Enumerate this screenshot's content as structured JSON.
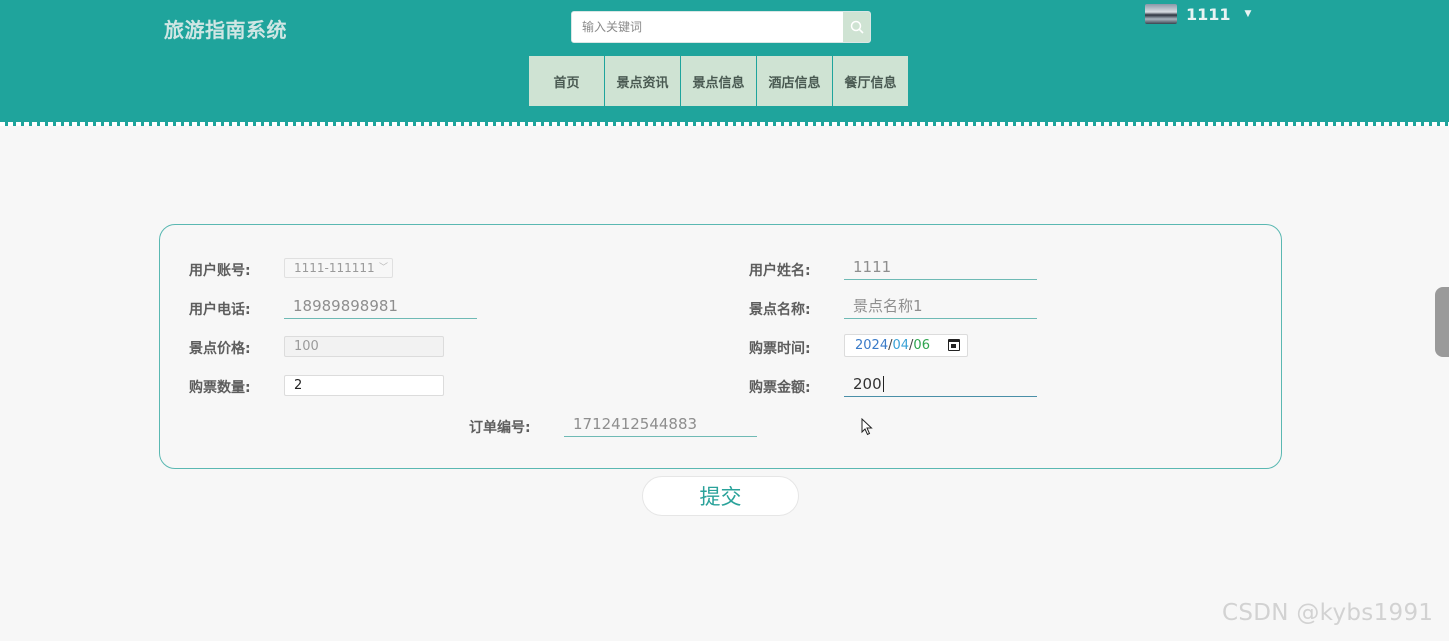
{
  "header": {
    "site_title": "旅游指南系统",
    "search_placeholder": "输入关键词",
    "user_name": "1111",
    "nav": [
      "首页",
      "景点资讯",
      "景点信息",
      "酒店信息",
      "餐厅信息"
    ]
  },
  "form": {
    "account_label": "用户账号:",
    "account_value": "1111-111111",
    "name_label": "用户姓名:",
    "name_value": "1111",
    "phone_label": "用户电话:",
    "phone_value": "18989898981",
    "spot_label": "景点名称:",
    "spot_value": "景点名称1",
    "price_label": "景点价格:",
    "price_value": "100",
    "time_label": "购票时间:",
    "date_year": "2024",
    "date_month": "04",
    "date_day": "06",
    "qty_label": "购票数量:",
    "qty_value": "2",
    "amount_label": "购票金额:",
    "amount_value": "200",
    "order_label": "订单编号:",
    "order_value": "1712412544883",
    "submit_label": "提交"
  },
  "watermark": "CSDN @kybs1991",
  "colors": {
    "header_bg": "#1fa49c",
    "nav_bg": "#cfe3d3",
    "panel_border": "#5ab8b2",
    "accent": "#2aa29a"
  }
}
